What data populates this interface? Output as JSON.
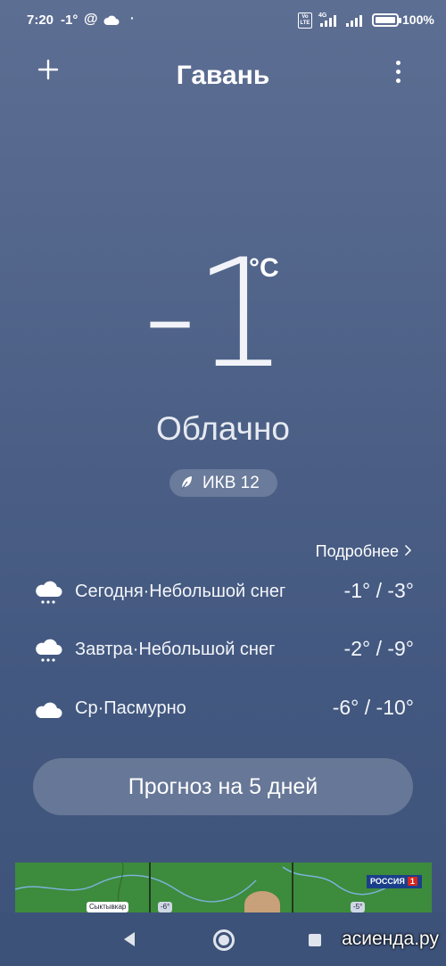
{
  "status_bar": {
    "time": "7:20",
    "temperature": "-1°",
    "at_symbol": "@",
    "dot": "·",
    "volte": "Vo LTE",
    "network": "4G",
    "battery_percent": "100%",
    "battery_level": 1.0,
    "icons": [
      "cloud-icon",
      "signal-icon",
      "battery-icon"
    ]
  },
  "header": {
    "city": "Гавань",
    "add_icon": "plus-icon",
    "more_icon": "more-vert-icon"
  },
  "current": {
    "temperature": "-1",
    "unit": "°C",
    "condition": "Облачно",
    "aqi_label": "ИКВ 12",
    "aqi_icon": "leaf-icon"
  },
  "forecast": {
    "details_label": "Подробнее",
    "days": [
      {
        "label": "Сегодня·Небольшой снег",
        "range": "-1° / -3°",
        "icon": "snow-cloud-icon"
      },
      {
        "label": "Завтра·Небольшой снег",
        "range": "-2° / -9°",
        "icon": "snow-cloud-icon"
      },
      {
        "label": "Ср·Пасмурно",
        "range": "-6° / -10°",
        "icon": "cloud-icon"
      }
    ],
    "five_day_button": "Прогноз на 5 дней"
  },
  "ad": {
    "logo": "РОССИЯ",
    "logo_number": "1",
    "city_tag": "Сыктывкар",
    "temp_tags": [
      "-6°",
      "-5°"
    ]
  },
  "nav": {
    "watermark": "асиенда.ру"
  },
  "colors": {
    "background_top": "#5d6e93",
    "background_bottom": "#3e5379",
    "text": "#ffffff"
  }
}
